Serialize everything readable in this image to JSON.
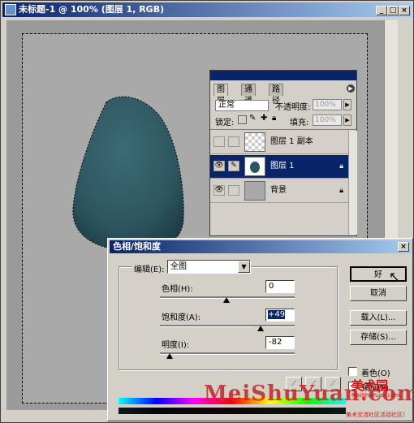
{
  "window": {
    "title": "未标题-1 @ 100% (图层 1, RGB)",
    "min_glyph": "_",
    "max_glyph": "□",
    "close_glyph": "×"
  },
  "layers_panel": {
    "tabs": [
      "图层",
      "通道",
      "路径"
    ],
    "blend_mode": "正常",
    "opacity_label": "不透明度:",
    "opacity_value": "100%",
    "lock_label": "锁定:",
    "fill_label": "填充:",
    "fill_value": "100%",
    "layers": [
      {
        "name": "图层 1 副本",
        "visible": false,
        "selected": false
      },
      {
        "name": "图层 1",
        "visible": true,
        "selected": true
      },
      {
        "name": "背景",
        "visible": true,
        "selected": false
      }
    ]
  },
  "dialog": {
    "title": "色相/饱和度",
    "edit_label": "编辑(E):",
    "edit_value": "全图",
    "hue_label": "色相(H):",
    "hue_value": "0",
    "saturation_label": "饱和度(A):",
    "saturation_value": "+49",
    "lightness_label": "明度(I):",
    "lightness_value": "-82",
    "ok_label": "好",
    "cancel_label": "取消",
    "load_label": "载入(L)...",
    "save_label": "存储(S)...",
    "colorize_label": "着色(O)",
    "preview_label": "预览(P)",
    "colorize_checked": false,
    "preview_checked": true
  },
  "watermark": {
    "latin": "MeiShuYuan.com",
    "cn": "美术园",
    "sub": "MeiShuYuan.com",
    "tagline": "美术交流社区活动社区！"
  },
  "colors": {
    "titlebar_start": "#0a246a",
    "titlebar_end": "#a6caf0",
    "shape_fill": "#2d5560",
    "dialog_bg": "#d4d0c8"
  }
}
